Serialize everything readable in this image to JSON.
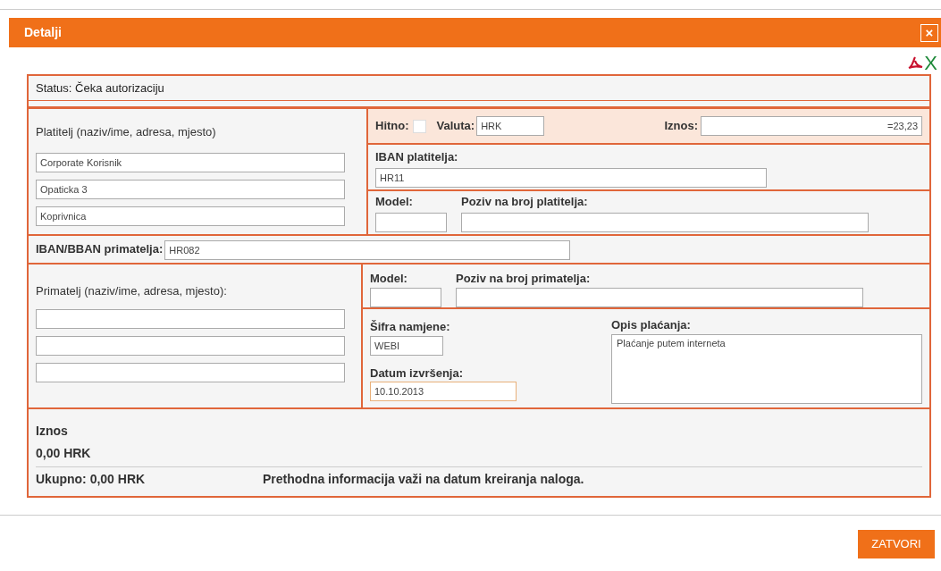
{
  "dialog": {
    "title": "Detalji",
    "close": "×"
  },
  "export": {
    "excel": "X"
  },
  "status": "Status: Čeka autorizaciju",
  "payer": {
    "label": "Platitelj (naziv/ime, adresa, mjesto)",
    "lines": [
      "Corporate Korisnik",
      "Opaticka 3",
      "Koprivnica"
    ]
  },
  "urgent": {
    "label": "Hitno:",
    "checked": false
  },
  "currency": {
    "label": "Valuta:",
    "value": "HRK"
  },
  "amount": {
    "label": "Iznos:",
    "value": "=23,23"
  },
  "payer_iban": {
    "label": "IBAN platitelja:",
    "value": "HR11"
  },
  "payer_model": {
    "label": "Model:",
    "ref_label": "Poziv na broj platitelja:"
  },
  "payee_iban": {
    "label": "IBAN/BBAN primatelja:",
    "value": "HR082"
  },
  "payee": {
    "label": "Primatelj (naziv/ime, adresa, mjesto):"
  },
  "payee_model": {
    "label": "Model:",
    "ref_label": "Poziv na broj primatelja:"
  },
  "purpose": {
    "label": "Šifra namjene:",
    "value": "WEBI"
  },
  "date": {
    "label": "Datum izvršenja:",
    "value": "10.10.2013"
  },
  "description": {
    "label": "Opis plaćanja:",
    "value": "Plaćanje putem interneta"
  },
  "summary": {
    "title": "Iznos",
    "amount": "0,00 HRK",
    "total": "Ukupno: 0,00 HRK",
    "note": "Prethodna informacija važi na datum kreiranja naloga."
  },
  "buttons": [
    "ZATVORI"
  ]
}
